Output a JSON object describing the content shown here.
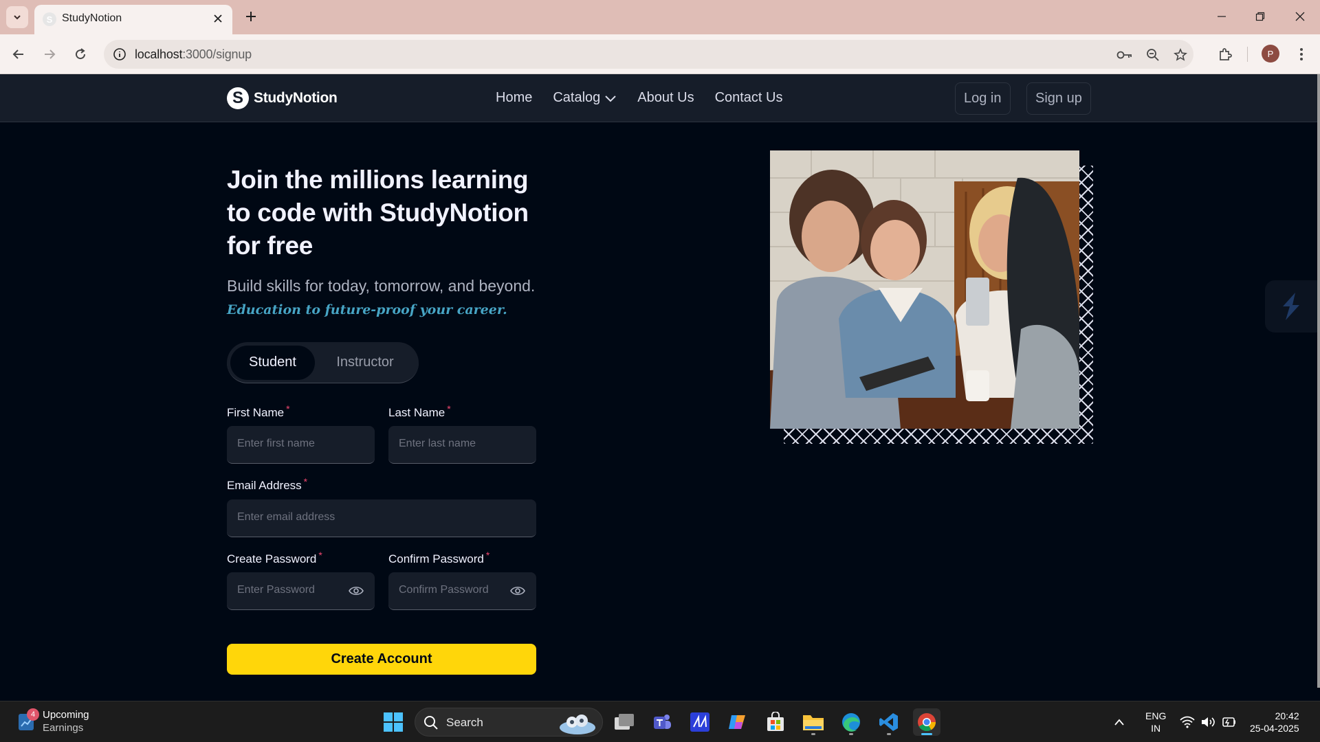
{
  "browser": {
    "tab_title": "StudyNotion",
    "url_host": "localhost",
    "url_path": ":3000/signup"
  },
  "site": {
    "brand": "StudyNotion",
    "logo_letter": "S",
    "nav": [
      "Home",
      "Catalog",
      "About Us",
      "Contact Us"
    ],
    "login_label": "Log in",
    "signup_label": "Sign up"
  },
  "hero": {
    "heading": "Join the millions learning to code with StudyNotion for free",
    "subheading": "Build skills for today, tomorrow, and beyond.",
    "highlight": "Education to future-proof your career."
  },
  "role_tabs": {
    "student": "Student",
    "instructor": "Instructor",
    "selected": "Student"
  },
  "form": {
    "first_name": {
      "label": "First Name",
      "placeholder": "Enter first name"
    },
    "last_name": {
      "label": "Last Name",
      "placeholder": "Enter last name"
    },
    "email": {
      "label": "Email Address",
      "placeholder": "Enter email address"
    },
    "password": {
      "label": "Create Password",
      "placeholder": "Enter Password"
    },
    "confirm_password": {
      "label": "Confirm Password",
      "placeholder": "Confirm Password"
    },
    "required_mark": "*",
    "submit_label": "Create Account"
  },
  "colors": {
    "page_bg": "#000814",
    "nav_bg": "#161d29",
    "accent_yellow": "#ffd60a",
    "highlight_blue": "#47a5c5",
    "required_red": "#ef476f"
  },
  "taskbar": {
    "widget_badge": "4",
    "widget_title": "Upcoming",
    "widget_subtitle": "Earnings",
    "search_label": "Search",
    "lang_line1": "ENG",
    "lang_line2": "IN",
    "time": "20:42",
    "date": "25-04-2025",
    "apps": [
      "start-icon",
      "task-view-icon",
      "teams-icon",
      "vscode-alt-icon",
      "copilot-icon",
      "store-icon",
      "file-explorer-icon",
      "edge-icon",
      "vscode-icon",
      "chrome-icon"
    ]
  }
}
